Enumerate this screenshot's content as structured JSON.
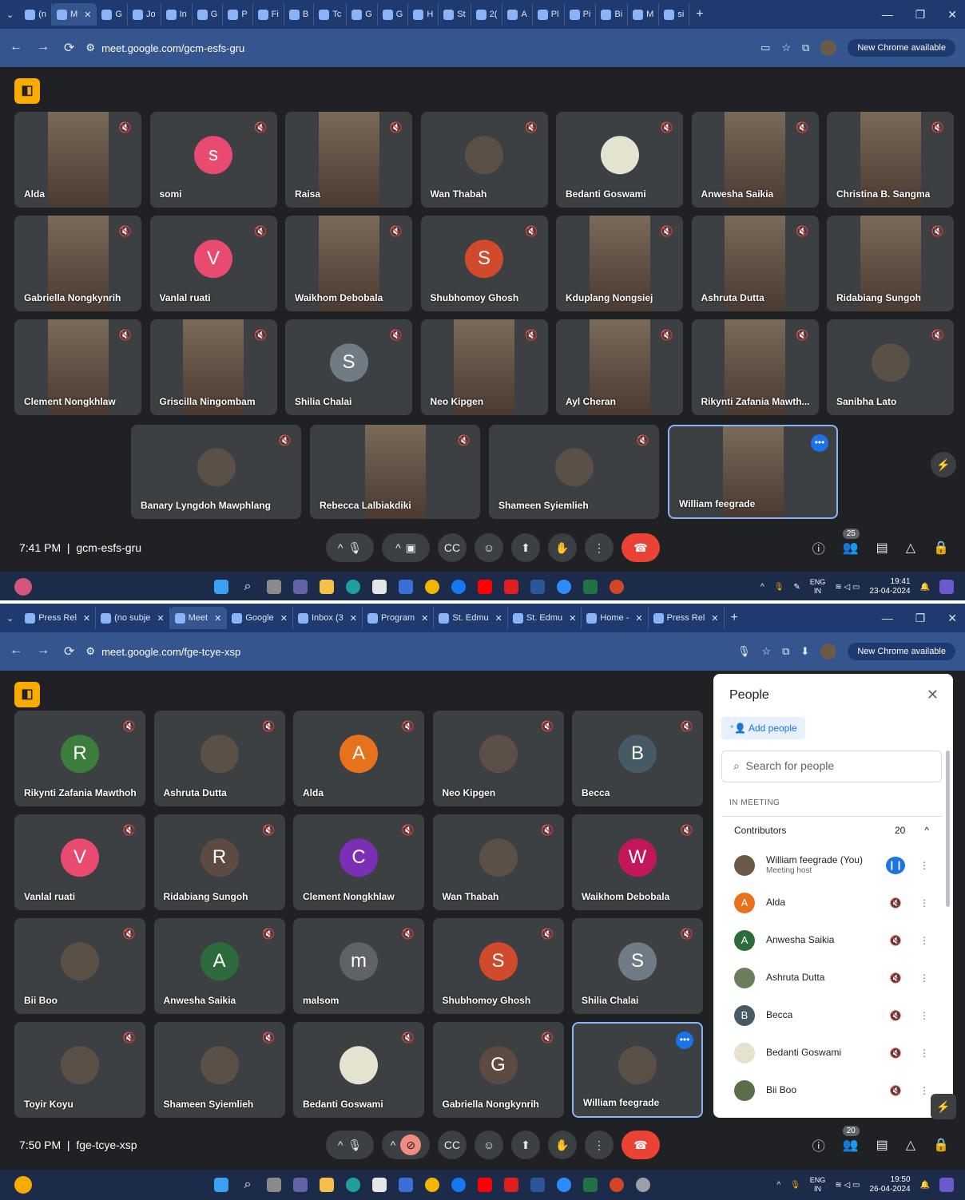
{
  "shot1": {
    "tabs": [
      "(n",
      "M",
      "G",
      "Jo",
      "In",
      "G",
      "P",
      "Fi",
      "B",
      "Tc",
      "G",
      "G",
      "H",
      "St",
      "2(",
      "A",
      "Pl",
      "Pi",
      "Bi",
      "M",
      "si"
    ],
    "url": "meet.google.com/gcm-esfs-gru",
    "new_chrome": "New Chrome available",
    "tiles": [
      {
        "name": "Alda",
        "type": "photo"
      },
      {
        "name": "somi",
        "type": "avatar",
        "letter": "s",
        "color": "#e94a6f"
      },
      {
        "name": "Raisa",
        "type": "photo"
      },
      {
        "name": "Wan Thabah",
        "type": "round"
      },
      {
        "name": "Bedanti Goswami",
        "type": "round-light"
      },
      {
        "name": "Anwesha Saikia",
        "type": "photo"
      },
      {
        "name": "Christina B. Sangma",
        "type": "photo"
      },
      {
        "name": "Gabriella Nongkynrih",
        "type": "photo"
      },
      {
        "name": "Vanlal ruati",
        "type": "avatar",
        "letter": "V",
        "color": "#e94a6f"
      },
      {
        "name": "Waikhom Debobala",
        "type": "photo"
      },
      {
        "name": "Shubhomoy Ghosh",
        "type": "avatar",
        "letter": "S",
        "color": "#d14a2b"
      },
      {
        "name": "Kduplang Nongsiej",
        "type": "photo"
      },
      {
        "name": "Ashruta Dutta",
        "type": "photo"
      },
      {
        "name": "Ridabiang Sungoh",
        "type": "photo"
      },
      {
        "name": "Clement Nongkhlaw",
        "type": "photo"
      },
      {
        "name": "Griscilla Ningombam",
        "type": "photo"
      },
      {
        "name": "Shilia Chalai",
        "type": "avatar",
        "letter": "S",
        "color": "#6f7c85"
      },
      {
        "name": "Neo Kipgen",
        "type": "photo"
      },
      {
        "name": "Ayl Cheran",
        "type": "photo"
      },
      {
        "name": "Rikynti Zafania Mawth...",
        "type": "photo"
      },
      {
        "name": "Sanibha Lato",
        "type": "round"
      },
      {
        "name": "Banary Lyngdoh Mawphlang",
        "type": "round"
      },
      {
        "name": "Rebecca Lalbiakdiki",
        "type": "photo"
      },
      {
        "name": "Shameen Syiemlieh",
        "type": "round"
      },
      {
        "name": "William feegrade",
        "type": "photo"
      }
    ],
    "time": "7:41 PM",
    "code": "gcm-esfs-gru",
    "people_count": "25",
    "tray": {
      "lang1": "ENG",
      "lang2": "IN",
      "time": "19:41",
      "date": "23-04-2024"
    }
  },
  "shot2": {
    "tabs": [
      "Press Rel",
      "(no subje",
      "Meet",
      "Google",
      "Inbox (3",
      "Program",
      "St. Edmu",
      "St. Edmu",
      "Home -",
      "Press Rel"
    ],
    "url": "meet.google.com/fge-tcye-xsp",
    "new_chrome": "New Chrome available",
    "tiles": [
      {
        "name": "Rikynti Zafania Mawthoh",
        "type": "avatar",
        "letter": "R",
        "color": "#3b7d3b"
      },
      {
        "name": "Ashruta Dutta",
        "type": "round"
      },
      {
        "name": "Alda",
        "type": "avatar",
        "letter": "A",
        "color": "#e8711c"
      },
      {
        "name": "Neo Kipgen",
        "type": "round"
      },
      {
        "name": "Becca",
        "type": "avatar",
        "letter": "B",
        "color": "#455a64"
      },
      {
        "name": "Vanlal ruati",
        "type": "avatar",
        "letter": "V",
        "color": "#e94a6f"
      },
      {
        "name": "Ridabiang Sungoh",
        "type": "avatar",
        "letter": "R",
        "color": "#5d4a40"
      },
      {
        "name": "Clement Nongkhlaw",
        "type": "avatar",
        "letter": "C",
        "color": "#7b2fb5"
      },
      {
        "name": "Wan Thabah",
        "type": "round"
      },
      {
        "name": "Waikhom Debobala",
        "type": "avatar",
        "letter": "W",
        "color": "#c2185b"
      },
      {
        "name": "Bii Boo",
        "type": "round"
      },
      {
        "name": "Anwesha Saikia",
        "type": "avatar",
        "letter": "A",
        "color": "#2e6b3c"
      },
      {
        "name": "malsom",
        "type": "avatar",
        "letter": "m",
        "color": "#5f6368"
      },
      {
        "name": "Shubhomoy Ghosh",
        "type": "avatar",
        "letter": "S",
        "color": "#d14a2b"
      },
      {
        "name": "Shilia Chalai",
        "type": "avatar",
        "letter": "S",
        "color": "#6f7c85"
      },
      {
        "name": "Toyir Koyu",
        "type": "round"
      },
      {
        "name": "Shameen Syiemlieh",
        "type": "round"
      },
      {
        "name": "Bedanti Goswami",
        "type": "round-light"
      },
      {
        "name": "Gabriella Nongkynrih",
        "type": "avatar",
        "letter": "G",
        "color": "#5d4a40"
      },
      {
        "name": "William feegrade",
        "type": "round"
      }
    ],
    "time": "7:50 PM",
    "code": "fge-tcye-xsp",
    "people_count": "20",
    "tray": {
      "lang1": "ENG",
      "lang2": "IN",
      "time": "19:50",
      "date": "26-04-2024"
    },
    "people_panel": {
      "title": "People",
      "add_people": "Add people",
      "search_placeholder": "Search for people",
      "section": "IN MEETING",
      "group": "Contributors",
      "group_count": "20",
      "people": [
        {
          "name": "William feegrade (You)",
          "sub": "Meeting host",
          "color": "#6b5a48",
          "letter": "",
          "status": "active"
        },
        {
          "name": "Alda",
          "sub": "",
          "color": "#e8711c",
          "letter": "A",
          "status": "muted"
        },
        {
          "name": "Anwesha Saikia",
          "sub": "",
          "color": "#2e6b3c",
          "letter": "A",
          "status": "muted"
        },
        {
          "name": "Ashruta Dutta",
          "sub": "",
          "color": "#6b7d5a",
          "letter": "",
          "status": "muted"
        },
        {
          "name": "Becca",
          "sub": "",
          "color": "#455a64",
          "letter": "B",
          "status": "muted"
        },
        {
          "name": "Bedanti Goswami",
          "sub": "",
          "color": "#e3e3d0",
          "letter": "",
          "status": "muted"
        },
        {
          "name": "Bii Boo",
          "sub": "",
          "color": "#5b6e4a",
          "letter": "",
          "status": "muted"
        }
      ]
    }
  }
}
